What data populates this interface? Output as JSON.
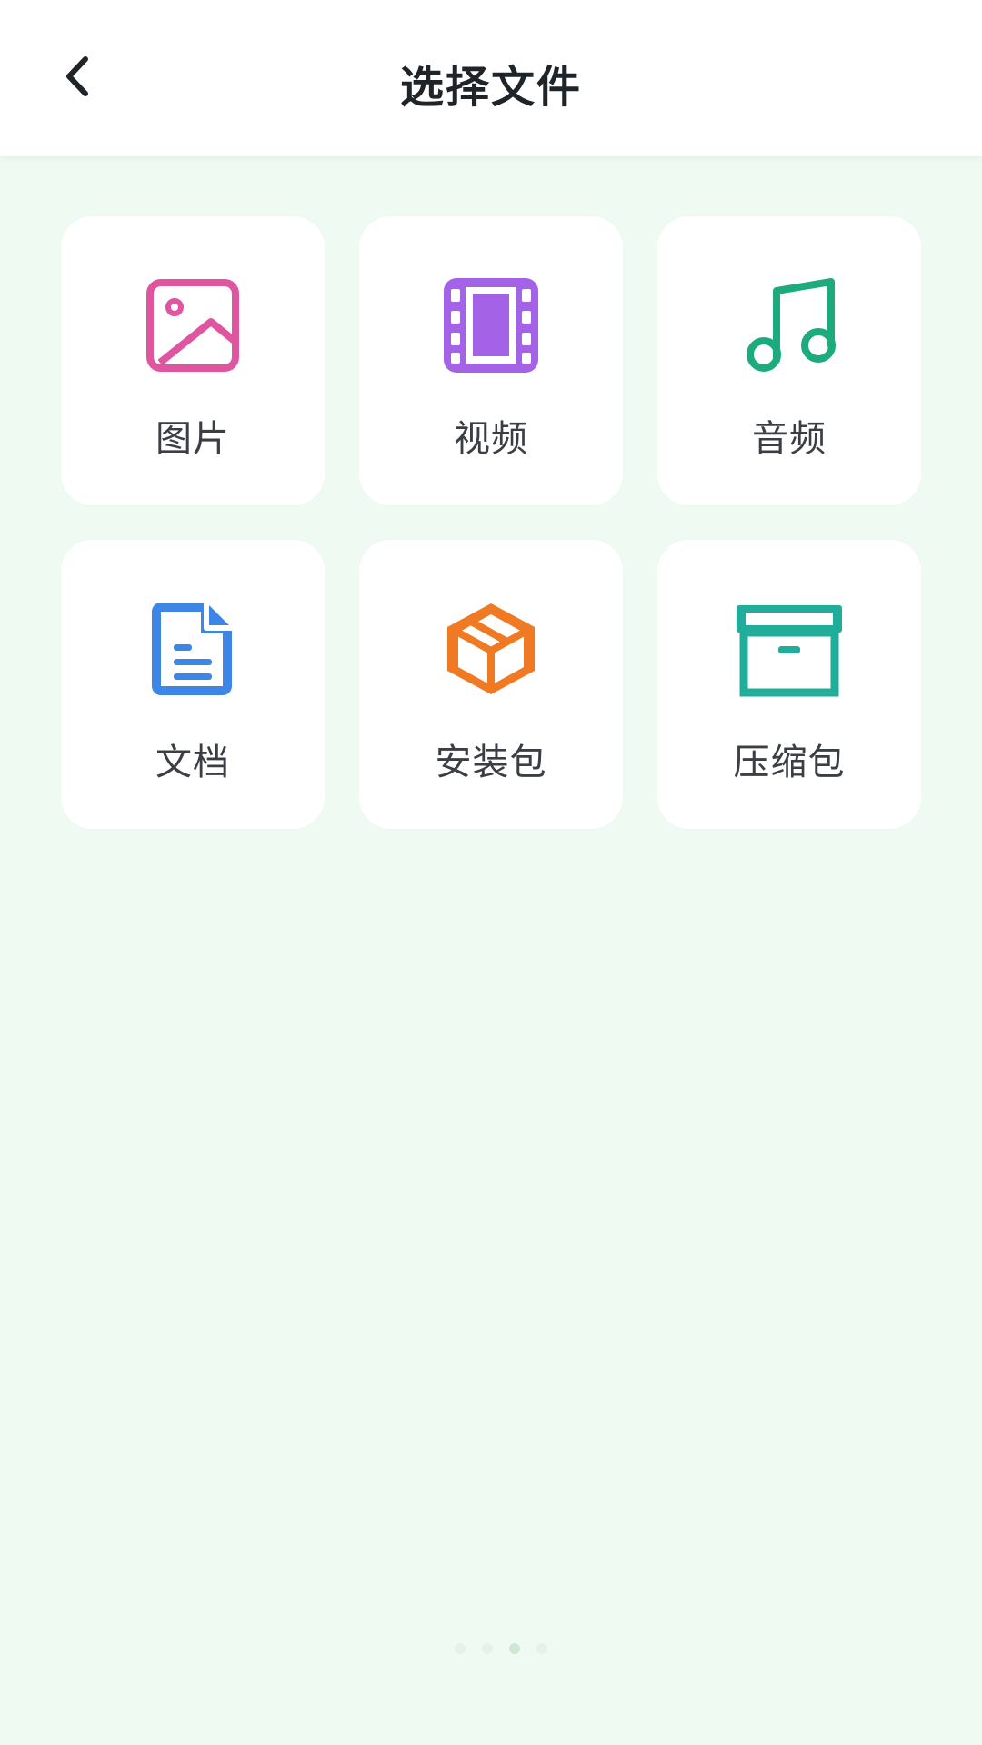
{
  "header": {
    "title": "选择文件",
    "back_icon": "chevron-left-icon"
  },
  "categories": [
    {
      "label": "图片",
      "icon": "image-icon",
      "color": "#E0559F"
    },
    {
      "label": "视频",
      "icon": "film-icon",
      "color": "#A463E6"
    },
    {
      "label": "音频",
      "icon": "music-note-icon",
      "color": "#1DAA7D"
    },
    {
      "label": "文档",
      "icon": "document-icon",
      "color": "#3D86E6"
    },
    {
      "label": "安装包",
      "icon": "package-box-icon",
      "color": "#F07A24"
    },
    {
      "label": "压缩包",
      "icon": "archive-box-icon",
      "color": "#20AE9A"
    }
  ],
  "colors": {
    "background": "#EFFBF2",
    "header_bg": "#FFFFFF",
    "tile_bg": "#FFFFFF",
    "title_text": "#1F2428",
    "label_text": "#3B3F45"
  },
  "pager": {
    "count": 4,
    "active_index": 2
  }
}
